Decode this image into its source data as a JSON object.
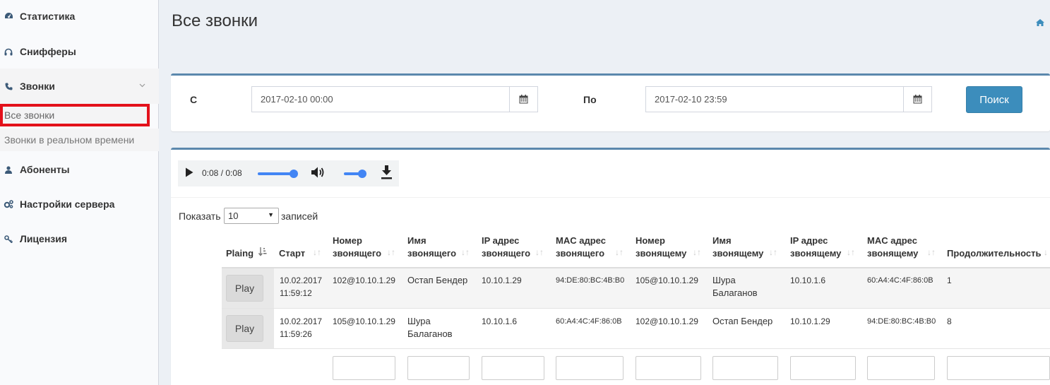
{
  "sidebar": {
    "items": [
      {
        "label": "Статистика",
        "icon": "dashboard-icon"
      },
      {
        "label": "Снифферы",
        "icon": "headphones-icon"
      },
      {
        "label": "Звонки",
        "icon": "phone-icon"
      },
      {
        "label": "Абоненты",
        "icon": "user-icon"
      },
      {
        "label": "Настройки сервера",
        "icon": "gears-icon"
      },
      {
        "label": "Лицензия",
        "icon": "key-icon"
      }
    ],
    "subitems": [
      {
        "label": "Все звонки"
      },
      {
        "label": "Звонки в реальном времени"
      }
    ]
  },
  "header": {
    "title": "Все звонки"
  },
  "filter": {
    "from_label": "С",
    "from_value": "2017-02-10 00:00",
    "to_label": "По",
    "to_value": "2017-02-10 23:59",
    "search_label": "Поиск"
  },
  "player": {
    "time": "0:08 / 0:08",
    "progress": 1.0,
    "volume": 1.0
  },
  "table": {
    "show_label": "Показать",
    "page_length": "10",
    "records_label": "записей",
    "headers": [
      {
        "line1": "Plaing",
        "line2": ""
      },
      {
        "line1": "Старт",
        "line2": ""
      },
      {
        "line1": "Номер",
        "line2": "звонящего"
      },
      {
        "line1": "Имя",
        "line2": "звонящего"
      },
      {
        "line1": "IP адрес",
        "line2": "звонящего"
      },
      {
        "line1": "MAC адрес",
        "line2": "звонящего"
      },
      {
        "line1": "Номер",
        "line2": "звонящему"
      },
      {
        "line1": "Имя",
        "line2": "звонящему"
      },
      {
        "line1": "IP адрес",
        "line2": "звонящему"
      },
      {
        "line1": "MAC адрес",
        "line2": "звонящему"
      },
      {
        "line1": "Продолжительность",
        "line2": ""
      }
    ],
    "rows": [
      {
        "play": "Play",
        "start_date": "10.02.2017",
        "start_time": "11:59:12",
        "caller_number": "102@10.10.1.29",
        "caller_name_1": "Остап Бендер",
        "caller_name_2": "",
        "caller_ip": "10.10.1.29",
        "caller_mac": "94:DE:80:BC:4B:B0",
        "callee_number": "105@10.10.1.29",
        "callee_name_1": "Шура",
        "callee_name_2": "Балаганов",
        "callee_ip": "10.10.1.6",
        "callee_mac": "60:A4:4C:4F:86:0B",
        "duration": "1"
      },
      {
        "play": "Play",
        "start_date": "10.02.2017",
        "start_time": "11:59:26",
        "caller_number": "105@10.10.1.29",
        "caller_name_1": "Шура",
        "caller_name_2": "Балаганов",
        "caller_ip": "10.10.1.6",
        "caller_mac": "60:A4:4C:4F:86:0B",
        "callee_number": "102@10.10.1.29",
        "callee_name_1": "Остап Бендер",
        "callee_name_2": "",
        "callee_ip": "10.10.1.29",
        "callee_mac": "94:DE:80:BC:4B:B0",
        "duration": "8"
      }
    ]
  }
}
